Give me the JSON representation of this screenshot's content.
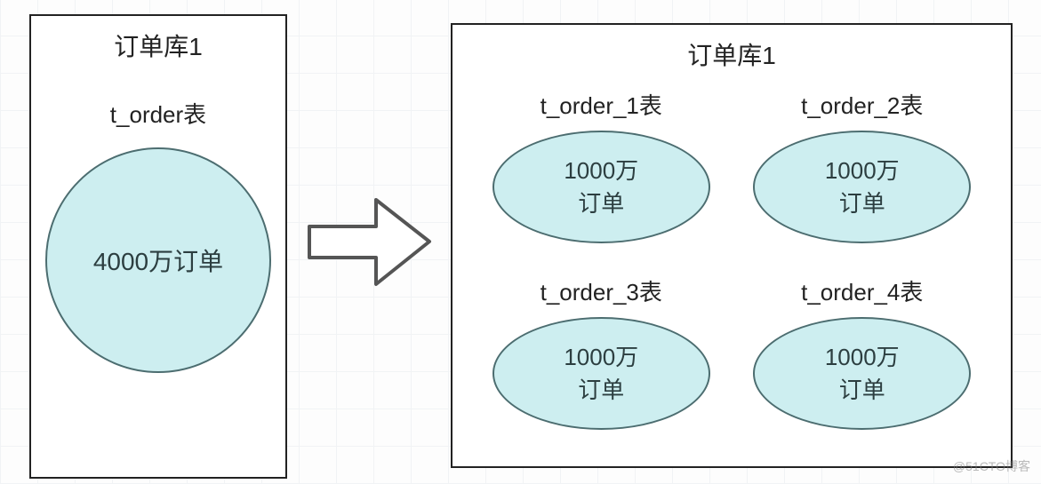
{
  "left": {
    "title": "订单库1",
    "table_label": "t_order表",
    "circle_text": "4000万订单"
  },
  "right": {
    "title": "订单库1",
    "tables": [
      {
        "label": "t_order_1表",
        "line1": "1000万",
        "line2": "订单"
      },
      {
        "label": "t_order_2表",
        "line1": "1000万",
        "line2": "订单"
      },
      {
        "label": "t_order_3表",
        "line1": "1000万",
        "line2": "订单"
      },
      {
        "label": "t_order_4表",
        "line1": "1000万",
        "line2": "订单"
      }
    ]
  },
  "watermark": "@51CTO博客"
}
